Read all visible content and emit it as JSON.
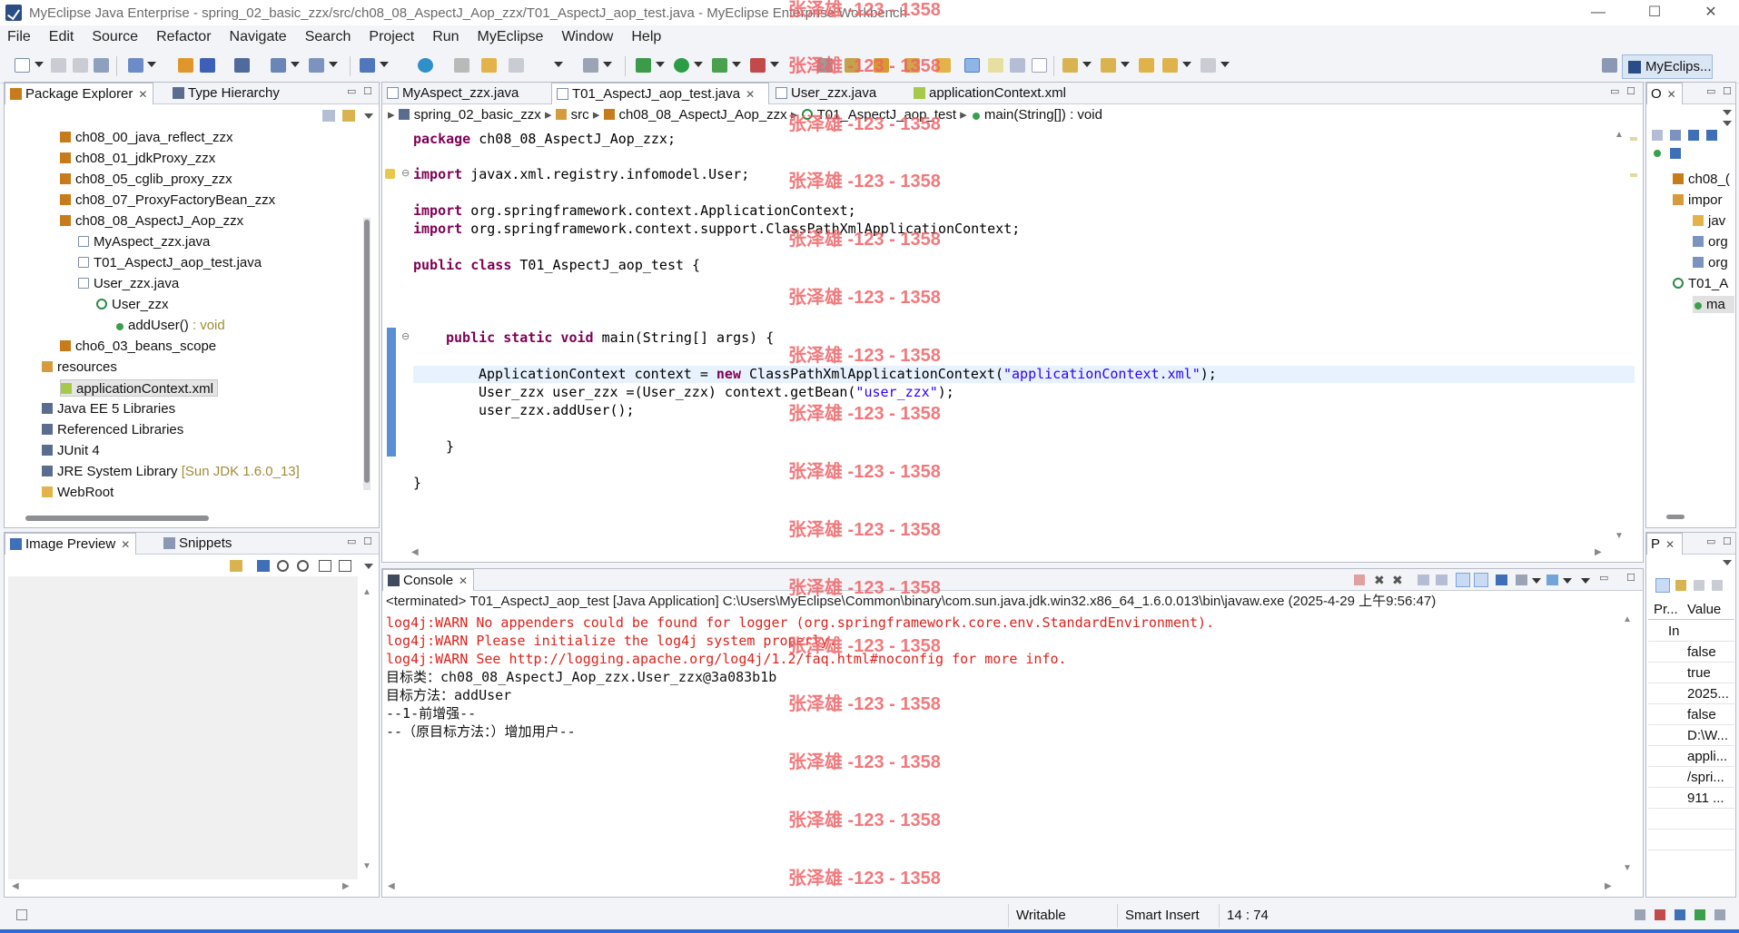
{
  "window": {
    "title": "MyEclipse Java Enterprise - spring_02_basic_zzx/src/ch08_08_AspectJ_Aop_zzx/T01_AspectJ_aop_test.java - MyEclipse Enterprise Workbench",
    "min_label": "—",
    "max_label": "☐",
    "close_label": "✕"
  },
  "menu": [
    "File",
    "Edit",
    "Source",
    "Refactor",
    "Navigate",
    "Search",
    "Project",
    "Run",
    "MyEclipse",
    "Window",
    "Help"
  ],
  "toolbar": {
    "perspective_label": "MyEclips..."
  },
  "package_explorer": {
    "tabs": [
      {
        "label": "Package Explorer"
      },
      {
        "label": "Type Hierarchy"
      }
    ],
    "tree": [
      {
        "label": "ch08_00_java_reflect_zzx",
        "icon": "package-icon"
      },
      {
        "label": "ch08_01_jdkProxy_zzx",
        "icon": "package-icon"
      },
      {
        "label": "ch08_05_cglib_proxy_zzx",
        "icon": "package-icon"
      },
      {
        "label": "ch08_07_ProxyFactoryBean_zzx",
        "icon": "package-icon"
      },
      {
        "label": "ch08_08_AspectJ_Aop_zzx",
        "icon": "package-icon"
      },
      {
        "label": "MyAspect_zzx.java",
        "icon": "java-file-icon"
      },
      {
        "label": "T01_AspectJ_aop_test.java",
        "icon": "java-file-icon"
      },
      {
        "label": "User_zzx.java",
        "icon": "java-file-icon"
      },
      {
        "label": "User_zzx",
        "icon": "class-icon"
      },
      {
        "label": "addUser()",
        "suffix": " : void",
        "icon": "method-icon"
      },
      {
        "label": "cho6_03_beans_scope",
        "icon": "package-icon"
      },
      {
        "label": "resources",
        "icon": "source-folder-icon"
      },
      {
        "label": "applicationContext.xml",
        "icon": "xml-file-icon"
      },
      {
        "label": "Java EE 5 Libraries",
        "icon": "library-icon"
      },
      {
        "label": "Referenced Libraries",
        "icon": "library-icon"
      },
      {
        "label": "JUnit 4",
        "icon": "library-icon"
      },
      {
        "label": "JRE System Library",
        "suffix": " [Sun JDK 1.6.0_13]",
        "icon": "library-icon"
      },
      {
        "label": "WebRoot",
        "icon": "folder-icon"
      }
    ]
  },
  "image_preview": {
    "tabs": [
      {
        "label": "Image Preview"
      },
      {
        "label": "Snippets"
      }
    ]
  },
  "editor": {
    "tabs": [
      {
        "label": "MyAspect_zzx.java"
      },
      {
        "label": "T01_AspectJ_aop_test.java"
      },
      {
        "label": "User_zzx.java"
      },
      {
        "label": "applicationContext.xml"
      }
    ],
    "breadcrumb": [
      "spring_02_basic_zzx",
      "src",
      "ch08_08_AspectJ_Aop_zzx",
      "T01_AspectJ_aop_test",
      "main(String[]) : void"
    ],
    "code": {
      "l1_kw": "package",
      "l1_rest": " ch08_08_AspectJ_Aop_zzx;",
      "l2_kw": "import",
      "l2_rest": " javax.xml.registry.infomodel.User;",
      "l3_kw": "import",
      "l3_rest": " org.springframework.context.ApplicationContext;",
      "l4_kw": "import",
      "l4_rest": " org.springframework.context.support.ClassPathXmlApplicationContext;",
      "l5_kw": "public class",
      "l5_rest": " T01_AspectJ_aop_test {",
      "l6_kw": "public static void",
      "l6_rest": " main(String[] args) {",
      "l7_a": "ApplicationContext context = ",
      "l7_kw": "new",
      "l7_b": " ClassPathXmlApplicationContext(",
      "l7_str": "\"applicationContext.xml\"",
      "l7_c": ");",
      "l8_a": "User_zzx user_zzx =(User_zzx) context.getBean(",
      "l8_str": "\"user_zzx\"",
      "l8_c": ");",
      "l9": "user_zzx.addUser();",
      "l10": "}",
      "l11": "}"
    }
  },
  "console": {
    "tab_label": "Console",
    "terminated": "<terminated> T01_AspectJ_aop_test [Java Application] C:\\Users\\MyEclipse\\Common\\binary\\com.sun.java.jdk.win32.x86_64_1.6.0.013\\bin\\javaw.exe (2025-4-29 上午9:56:47)",
    "lines": [
      {
        "text": "log4j:WARN No appenders could be found for logger (org.springframework.core.env.StandardEnvironment).",
        "kind": "err"
      },
      {
        "text": "log4j:WARN Please initialize the log4j system properly.",
        "kind": "err"
      },
      {
        "text": "log4j:WARN See http://logging.apache.org/log4j/1.2/faq.html#noconfig for more info.",
        "kind": "err"
      },
      {
        "text": "目标类：ch08_08_AspectJ_Aop_zzx.User_zzx@3a083b1b",
        "kind": "out"
      },
      {
        "text": "目标方法：addUser",
        "kind": "out"
      },
      {
        "text": "--1-前增强--",
        "kind": "out"
      },
      {
        "text": "--（原目标方法：）增加用户--",
        "kind": "out"
      }
    ]
  },
  "outline": {
    "tab_label": "O",
    "items": [
      {
        "label": "ch08_("
      },
      {
        "label": "impor"
      },
      {
        "label": "jav"
      },
      {
        "label": "org"
      },
      {
        "label": "org"
      },
      {
        "label": "T01_A"
      },
      {
        "label": "ma"
      }
    ]
  },
  "properties": {
    "tab_label": "P",
    "header": {
      "col1": "Pr...",
      "col2": "Value"
    },
    "subheader": "In",
    "values": [
      "false",
      "true",
      "2025...",
      "false",
      "D:\\W...",
      "appli...",
      "/spri...",
      "911 ..."
    ]
  },
  "status": {
    "writable": "Writable",
    "insert_mode": "Smart Insert",
    "position": "14 : 74"
  },
  "watermark": "张泽雄 -123 - 1358"
}
